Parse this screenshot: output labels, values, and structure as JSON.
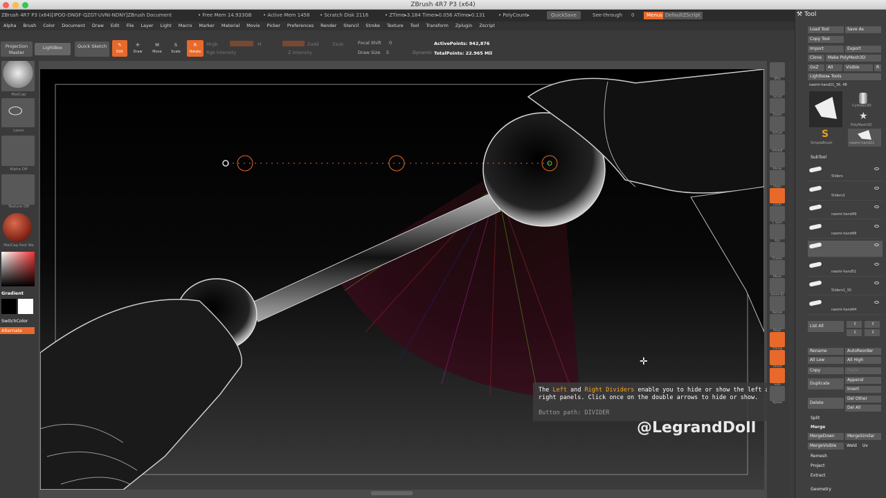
{
  "window": {
    "title": "ZBrush 4R7 P3 (x64)"
  },
  "infobar": {
    "doc": "ZBrush 4R7 P3 (x64)[IPOO-DNGF-QZGT-UVNI-NDNY]ZBrush Document",
    "free_mem": "• Free Mem 14.933GB",
    "active_mem": "• Active Mem 1458",
    "scratch": "• Scratch Disk 2116",
    "ztime": "• ZTime▸3.184 Timer▸0.056 ATime▸0.131",
    "polycounts": "• PolyCount▸",
    "quicksave": "QuickSave",
    "see_through": "See-through",
    "see_through_val": "0",
    "menus": "Menus",
    "default_script": "DefaultZScript"
  },
  "menu": [
    "Alpha",
    "Brush",
    "Color",
    "Document",
    "Draw",
    "Edit",
    "File",
    "Layer",
    "Light",
    "Macro",
    "Marker",
    "Material",
    "Movie",
    "Picker",
    "Preferences",
    "Render",
    "Stencil",
    "Stroke",
    "Texture",
    "Tool",
    "Transform",
    "Zplugin",
    "Zscript"
  ],
  "shelf": {
    "projection_master": "Projection Master",
    "lightbox": "LightBox",
    "quick_sketch": "Quick Sketch",
    "edit": "Edit",
    "draw": "Draw",
    "move": "Move",
    "scale": "Scale",
    "rotate": "Rotate",
    "mrgb": "Mrgb",
    "rgb_intensity": "Rgb Intensity",
    "m": "M",
    "zadd": "Zadd",
    "zsub": "Zsub",
    "z_intensity": "Z Intensity",
    "focal_shift": "Focal Shift",
    "focal_val": "0",
    "draw_size": "Draw Size",
    "draw_val": "5",
    "dynamic": "Dynamic",
    "active_points": "ActivePoints: 942,876",
    "total_points": "TotalPoints: 22.965 Mil"
  },
  "left_shelf": {
    "mat_label": "MatCap",
    "lasso": "Lasso",
    "alpha_off": "Alpha Off",
    "texture_off": "Texture Off",
    "matcap_red": "MatCap Red Wa",
    "gradient": "Gradient",
    "switch_color": "SwitchColor",
    "alternate": "Alternate"
  },
  "right_shelf": [
    "SPix",
    "Scroll",
    "Zoom",
    "Actual",
    "AAHalf",
    "Persp",
    "Floor",
    "Local",
    "L.Sym",
    "Xyz",
    "Frame",
    "Move",
    "Zoom3D",
    "Rotate",
    "PolyF",
    "Transp",
    "Ghost",
    "Solo",
    "Xpose"
  ],
  "tool_panel": {
    "title": "Tool",
    "load_tool": "Load Tool",
    "save_as": "Save As",
    "copy_tool": "Copy Tool",
    "import": "Import",
    "export": "Export",
    "clone": "Clone",
    "make_polymesh": "Make PolyMesh3D",
    "goz": "GoZ",
    "all": "All",
    "visible": "Visible",
    "r": "R",
    "lightbox_tools": "Lightbox▸ Tools",
    "current_tool": "naomi-hand21_36. 48",
    "cylinder": "Cylinder3D",
    "polymesh": "PolyMesh3D",
    "simplebrush": "SimpleBrush",
    "thumb4": "naomi-hand21",
    "subtool": "SubTool",
    "subtools": [
      "5liders",
      "5liders1",
      "naomi-hand49",
      "naomi-hand48",
      "",
      "naomi-hand51",
      "5liders1_30",
      "naomi-hand44"
    ],
    "list_all": "List All",
    "rename": "Rename",
    "autoreorder": "AutoReorder",
    "all_low": "All Low",
    "all_high": "All High",
    "copy": "Copy",
    "paste": "Paste",
    "duplicate": "Duplicate",
    "append": "Append",
    "insert": "Insert",
    "delete": "Delete",
    "del_other": "Del Other",
    "del_all": "Del All",
    "split": "Split",
    "merge": "Merge",
    "merge_down": "MergeDown",
    "merge_similar": "MergeSimilar",
    "merge_visible": "MergeVisible",
    "weld": "Weld",
    "uv": "Uv",
    "remesh": "Remesh",
    "project": "Project",
    "extract": "Extract",
    "geometry": "Geometry"
  },
  "tooltip": {
    "the": "The ",
    "left": "Left",
    "and": " and ",
    "right": "Right Dividers",
    "rest1": " enable you to hide or show the left and",
    "line2": "right panels. Click once on the double arrows to hide or show.",
    "path": "Button path: DIVIDER"
  },
  "watermark": "@LegrandDoll",
  "colors": {
    "accent": "#e8692a",
    "panel": "#3a3a3a",
    "canvas_bg": "#000000"
  }
}
